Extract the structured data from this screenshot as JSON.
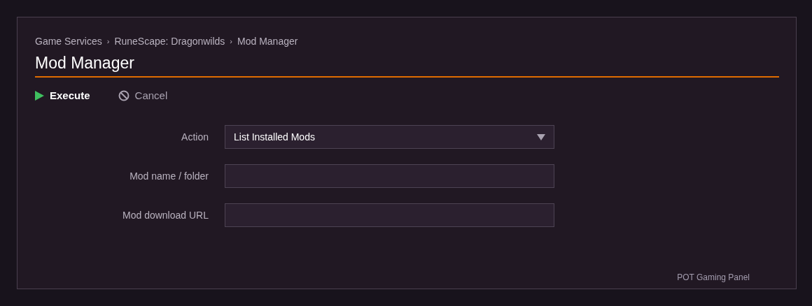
{
  "breadcrumbs": [
    "Game Services",
    "RuneScape: Dragonwilds",
    "Mod Manager"
  ],
  "breadcrumb_separator": "›",
  "title": "Mod Manager",
  "toolbar": [
    {
      "kind": "execute",
      "label": "Execute"
    },
    {
      "kind": "cancel",
      "label": "Cancel"
    }
  ],
  "form": [
    {
      "kind": "select",
      "label": "Action",
      "value": "List Installed Mods"
    },
    {
      "kind": "text",
      "label": "Mod name / folder"
    },
    {
      "kind": "text",
      "label": "Mod download URL"
    }
  ],
  "footer": "POT Gaming Panel"
}
